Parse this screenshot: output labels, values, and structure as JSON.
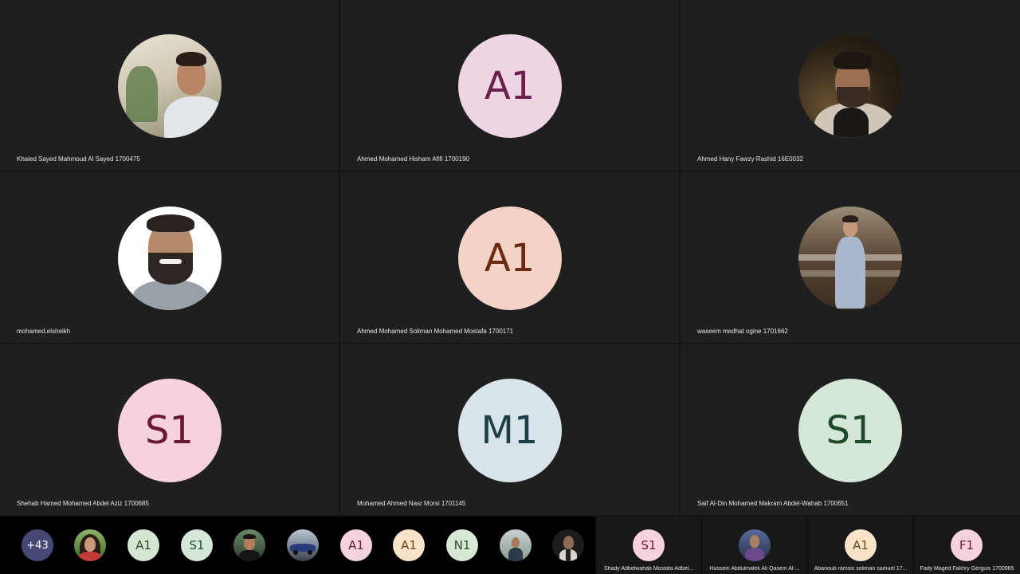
{
  "participants": [
    {
      "name": "Khaled Sayed Mahmoud Al Sayed 1700475",
      "initials": "",
      "photo": "photo-room-man"
    },
    {
      "name": "Ahmed Mohamed Hisham Afifi 1700190",
      "initials": "A1",
      "bg": "#efd4e3",
      "fg": "#6b1f4e"
    },
    {
      "name": "Ahmed Hany Fawzy Rashid 16E0032",
      "initials": "",
      "photo": "photo-night-man"
    },
    {
      "name": "mohamed.elsheikh",
      "initials": "",
      "photo": "photo-bearded-man"
    },
    {
      "name": "Ahmed Mohamed Soliman Mohamed Mostafa 1700171",
      "initials": "A1",
      "bg": "#f3d3c6",
      "fg": "#6a2a14"
    },
    {
      "name": "waseem medhat ogine 1701662",
      "initials": "",
      "photo": "photo-suit-man"
    },
    {
      "name": "Shehab Hamed Mohamed Abdel Aziz 1700685",
      "initials": "S1",
      "bg": "#f5d2dc",
      "fg": "#6b1a33"
    },
    {
      "name": "Mohamed Ahmed Nasr Morsi 1701145",
      "initials": "M1",
      "bg": "#d8e4ea",
      "fg": "#1c3f48"
    },
    {
      "name": "Saif Al-Din Mohamed  Makram Abdel-Wahab 1700651",
      "initials": "S1",
      "bg": "#d5e8d7",
      "fg": "#1e4a2a"
    }
  ],
  "strip": {
    "overflow_count": "+43",
    "items": [
      {
        "initials": "",
        "photo": "photo-woman",
        "bg": "#a14d3d"
      },
      {
        "initials": "A1",
        "bg": "#d7e6d3",
        "fg": "#2b4a2a"
      },
      {
        "initials": "S1",
        "bg": "#d5e8d7",
        "fg": "#1e4a2a"
      },
      {
        "initials": "",
        "photo": "photo-man-dark",
        "bg": "#3a4a3a"
      },
      {
        "initials": "",
        "photo": "photo-car",
        "bg": "#5a6a80"
      },
      {
        "initials": "A1",
        "bg": "#f5d2df",
        "fg": "#6b1a3a"
      },
      {
        "initials": "A1",
        "bg": "#f6e3c9",
        "fg": "#6a4a14"
      },
      {
        "initials": "N1",
        "bg": "#d7e8d5",
        "fg": "#2a4a28"
      },
      {
        "initials": "",
        "photo": "photo-man-outdoor",
        "bg": "#8a9aa0"
      },
      {
        "initials": "",
        "photo": "photo-man-night",
        "bg": "#2a2a2a"
      }
    ]
  },
  "side": [
    {
      "name": "Shady Adbelwahab Mostafa Adbel...",
      "initials": "S1",
      "bg": "#f5d2dc",
      "fg": "#6b1a33"
    },
    {
      "name": "Hussein Abdulmalek Ali Qasem Al-...",
      "initials": "",
      "photo": "photo-side-man",
      "bg": "#4a4e6a"
    },
    {
      "name": "Abanoub ramsis soliman samuel 17...",
      "initials": "A1",
      "bg": "#f6e3c9",
      "fg": "#6a4a14"
    },
    {
      "name": "Fady Maged Fakhry Gerguis 1700965",
      "initials": "F1",
      "bg": "#f5d2dc",
      "fg": "#6b1a33"
    }
  ]
}
